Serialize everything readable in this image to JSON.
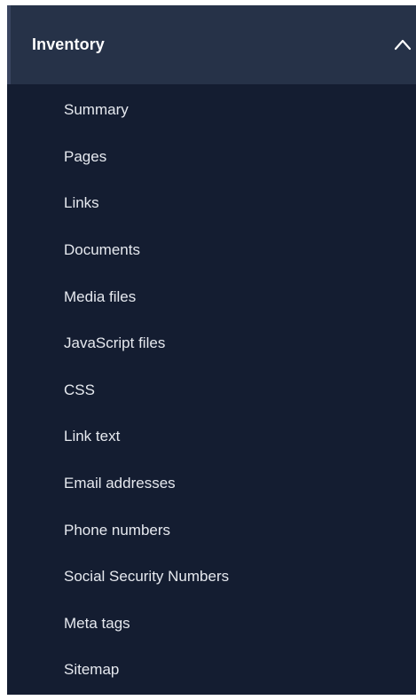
{
  "nav": {
    "section": {
      "title": "Inventory",
      "expanded": true,
      "toggle_icon": "chevron-up-icon"
    },
    "items": [
      {
        "label": "Summary"
      },
      {
        "label": "Pages"
      },
      {
        "label": "Links"
      },
      {
        "label": "Documents"
      },
      {
        "label": "Media files"
      },
      {
        "label": "JavaScript files"
      },
      {
        "label": "CSS"
      },
      {
        "label": "Link text"
      },
      {
        "label": "Email addresses"
      },
      {
        "label": "Phone numbers"
      },
      {
        "label": "Social Security Numbers"
      },
      {
        "label": "Meta tags"
      },
      {
        "label": "Sitemap"
      }
    ]
  },
  "colors": {
    "panel_background": "#141d31",
    "header_background": "#263248",
    "text": "#e6e9ef",
    "title_text": "#ffffff"
  }
}
